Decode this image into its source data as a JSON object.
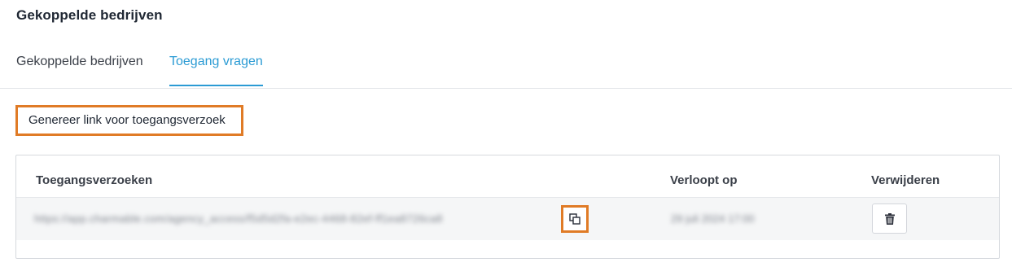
{
  "page": {
    "title": "Gekoppelde bedrijven"
  },
  "tabs": [
    {
      "label": "Gekoppelde bedrijven",
      "active": false
    },
    {
      "label": "Toegang vragen",
      "active": true
    }
  ],
  "actions": {
    "generate_link_label": "Genereer link voor toegangsverzoek"
  },
  "table": {
    "columns": [
      "Toegangsverzoeken",
      "Verloopt op",
      "Verwijderen"
    ],
    "rows": [
      {
        "link": "https://app.charmable.com/agency_access/f5d5d2fa-e2ec-4468-82ef-ff1ea8726ca8",
        "expires": "29 juli 2024 17:00",
        "copy_icon": "copy-icon",
        "delete_icon": "trash-icon"
      }
    ]
  },
  "colors": {
    "accent": "#2b9bd4",
    "highlight": "#e07b26"
  }
}
